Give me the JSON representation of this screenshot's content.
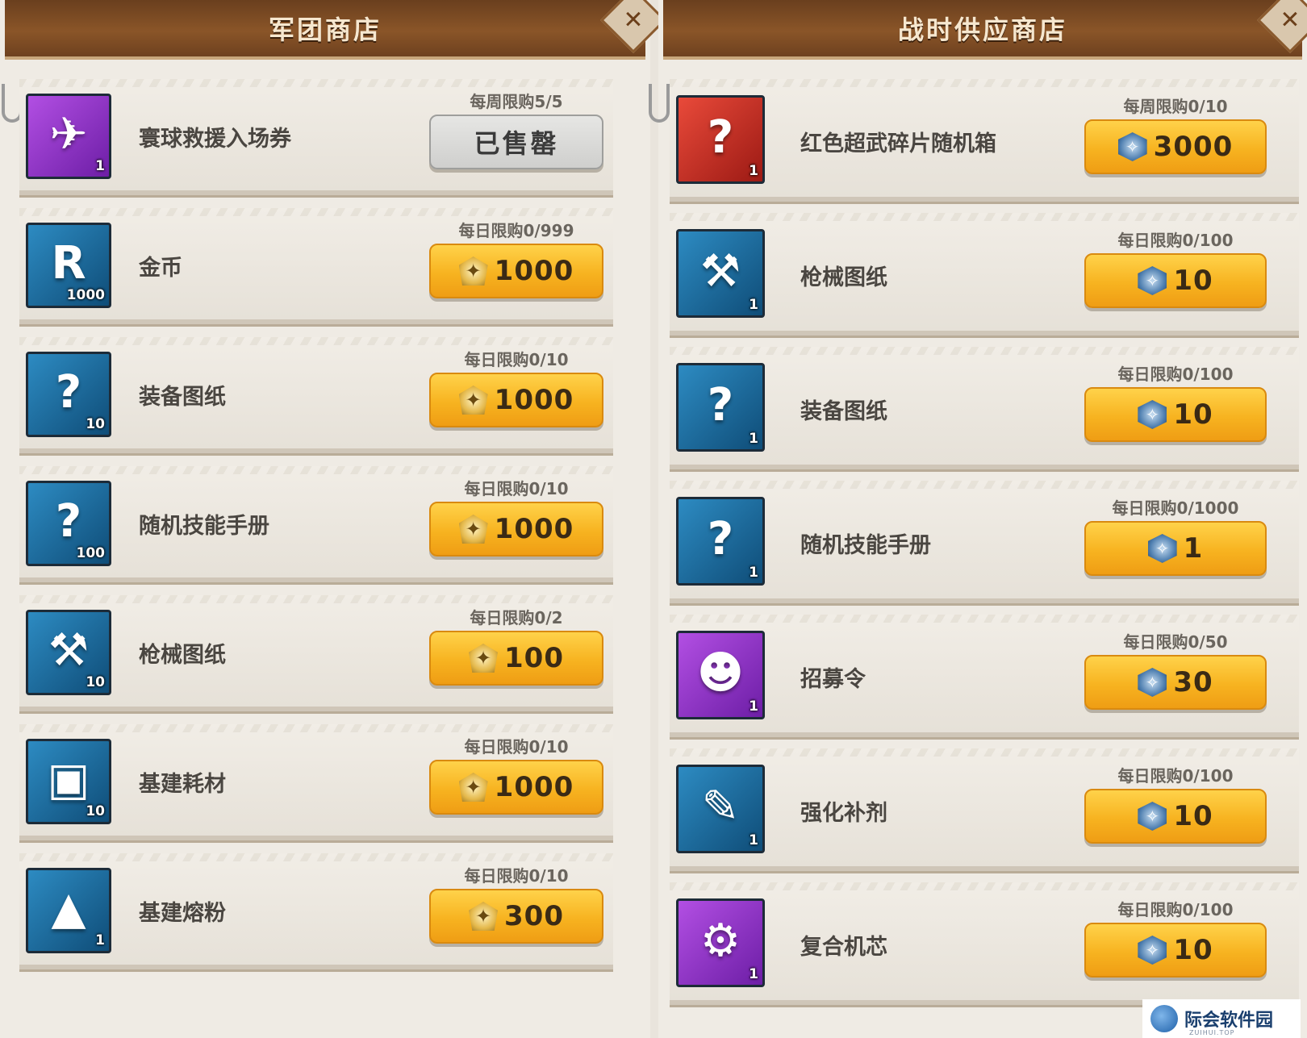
{
  "left_shop": {
    "title": "军团商店",
    "items": [
      {
        "name": "寰球救援入场券",
        "limit": "每周限购5/5",
        "price": "已售罄",
        "currency": "none",
        "count": "1",
        "icon": "ticket-icon",
        "tile": "purple",
        "sold_out": true
      },
      {
        "name": "金币",
        "limit": "每日限购0/999",
        "price": "1000",
        "currency": "legion-currency-icon",
        "count": "1000",
        "icon": "gold-coin-icon",
        "tile": "blue",
        "sold_out": false
      },
      {
        "name": "装备图纸",
        "limit": "每日限购0/10",
        "price": "1000",
        "currency": "legion-currency-icon",
        "count": "10",
        "icon": "equipment-blueprint-icon",
        "tile": "blue",
        "sold_out": false
      },
      {
        "name": "随机技能手册",
        "limit": "每日限购0/10",
        "price": "1000",
        "currency": "legion-currency-icon",
        "count": "100",
        "icon": "skill-manual-icon",
        "tile": "blue",
        "sold_out": false
      },
      {
        "name": "枪械图纸",
        "limit": "每日限购0/2",
        "price": "100",
        "currency": "legion-currency-icon",
        "count": "10",
        "icon": "firearm-blueprint-icon",
        "tile": "blue",
        "sold_out": false
      },
      {
        "name": "基建耗材",
        "limit": "每日限购0/10",
        "price": "1000",
        "currency": "legion-currency-icon",
        "count": "10",
        "icon": "construction-material-icon",
        "tile": "blue",
        "sold_out": false
      },
      {
        "name": "基建熔粉",
        "limit": "每日限购0/10",
        "price": "300",
        "currency": "legion-currency-icon",
        "count": "1",
        "icon": "melt-powder-icon",
        "tile": "blue",
        "sold_out": false
      }
    ]
  },
  "right_shop": {
    "title": "战时供应商店",
    "items": [
      {
        "name": "红色超武碎片随机箱",
        "limit": "每周限购0/10",
        "price": "3000",
        "currency": "war-supply-currency-icon",
        "count": "1",
        "icon": "red-mystery-box-icon",
        "tile": "red"
      },
      {
        "name": "枪械图纸",
        "limit": "每日限购0/100",
        "price": "10",
        "currency": "war-supply-currency-icon",
        "count": "1",
        "icon": "firearm-blueprint-icon",
        "tile": "blue"
      },
      {
        "name": "装备图纸",
        "limit": "每日限购0/100",
        "price": "10",
        "currency": "war-supply-currency-icon",
        "count": "1",
        "icon": "equipment-blueprint-icon",
        "tile": "blue"
      },
      {
        "name": "随机技能手册",
        "limit": "每日限购0/1000",
        "price": "1",
        "currency": "war-supply-currency-icon",
        "count": "1",
        "icon": "skill-manual-icon",
        "tile": "blue"
      },
      {
        "name": "招募令",
        "limit": "每日限购0/50",
        "price": "30",
        "currency": "war-supply-currency-icon",
        "count": "1",
        "icon": "recruit-order-icon",
        "tile": "purple"
      },
      {
        "name": "强化补剂",
        "limit": "每日限购0/100",
        "price": "10",
        "currency": "war-supply-currency-icon",
        "count": "1",
        "icon": "enhancement-syringe-icon",
        "tile": "blue"
      },
      {
        "name": "复合机芯",
        "limit": "每日限购0/100",
        "price": "10",
        "currency": "war-supply-currency-icon",
        "count": "1",
        "icon": "composite-core-icon",
        "tile": "purple"
      }
    ]
  },
  "watermark": {
    "text": "际会软件园",
    "sub": "ZUIHUI.TOP"
  },
  "colors": {
    "header_brown": "#7a4a22",
    "button_orange": "#f7b320",
    "sold_gray": "#cfcfcd"
  }
}
